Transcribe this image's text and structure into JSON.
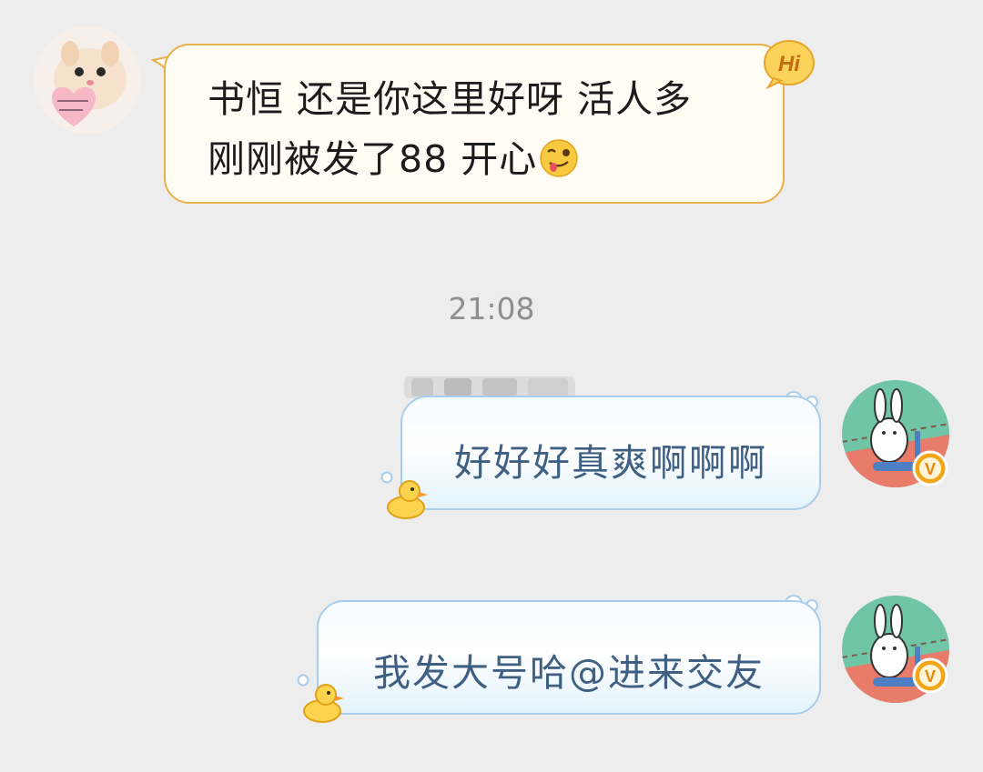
{
  "messages": {
    "incoming": {
      "line1": "书恒 还是你这里好呀 活人多",
      "line2": "刚刚被发了88 开心",
      "badge": "Hi",
      "emoji_icon": "yum-face-emoji-icon",
      "avatar_icon": "cat-avatar-icon"
    },
    "timestamp": "21:08",
    "outgoing": [
      {
        "text": "好好好真爽啊啊啊",
        "avatar_icon": "bunny-scooter-avatar-icon",
        "badge": "V"
      },
      {
        "text": "我发大号哈@进来交友",
        "avatar_icon": "bunny-scooter-avatar-icon",
        "badge": "V"
      }
    ]
  },
  "colors": {
    "background": "#ededed",
    "incoming_border": "#e8b04a",
    "incoming_fill": "#fffdf3",
    "outgoing_border": "#a9cdec",
    "outgoing_text": "#3f5f83",
    "timestamp": "#8e8e8e",
    "vip_badge": "#f2a516"
  }
}
